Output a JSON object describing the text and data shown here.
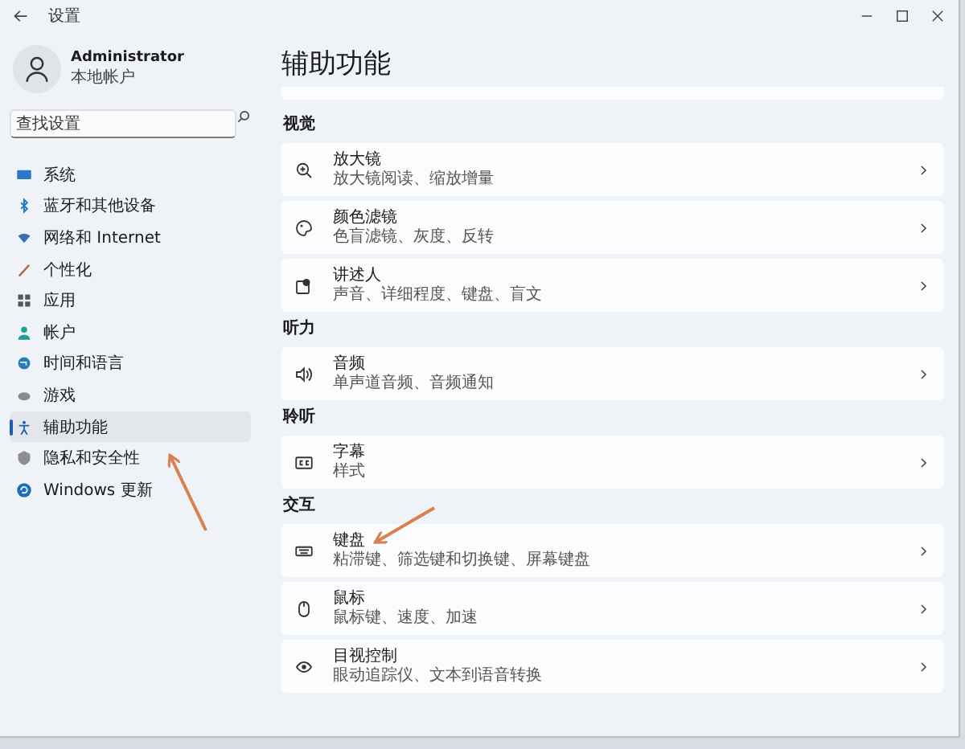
{
  "window": {
    "title": "设置"
  },
  "user": {
    "name": "Administrator",
    "account_type": "本地帐户"
  },
  "search": {
    "placeholder": "查找设置"
  },
  "sidebar": {
    "items": [
      {
        "label": "系统",
        "selected": false
      },
      {
        "label": "蓝牙和其他设备",
        "selected": false
      },
      {
        "label": "网络和 Internet",
        "selected": false
      },
      {
        "label": "个性化",
        "selected": false
      },
      {
        "label": "应用",
        "selected": false
      },
      {
        "label": "帐户",
        "selected": false
      },
      {
        "label": "时间和语言",
        "selected": false
      },
      {
        "label": "游戏",
        "selected": false
      },
      {
        "label": "辅助功能",
        "selected": true
      },
      {
        "label": "隐私和安全性",
        "selected": false
      },
      {
        "label": "Windows 更新",
        "selected": false
      }
    ]
  },
  "page": {
    "title": "辅助功能",
    "sections": [
      {
        "heading": "视觉",
        "items": [
          {
            "title": "放大镜",
            "description": "放大镜阅读、缩放增量"
          },
          {
            "title": "颜色滤镜",
            "description": "色盲滤镜、灰度、反转"
          },
          {
            "title": "讲述人",
            "description": "声音、详细程度、键盘、盲文"
          }
        ]
      },
      {
        "heading": "听力",
        "items": [
          {
            "title": "音频",
            "description": "单声道音频、音频通知"
          }
        ]
      },
      {
        "heading": "聆听",
        "items": [
          {
            "title": "字幕",
            "description": "样式"
          }
        ]
      },
      {
        "heading": "交互",
        "items": [
          {
            "title": "键盘",
            "description": "粘滞键、筛选键和切换键、屏幕键盘"
          },
          {
            "title": "鼠标",
            "description": "鼠标键、速度、加速"
          },
          {
            "title": "目视控制",
            "description": "眼动追踪仪、文本到语音转换"
          }
        ]
      }
    ]
  }
}
